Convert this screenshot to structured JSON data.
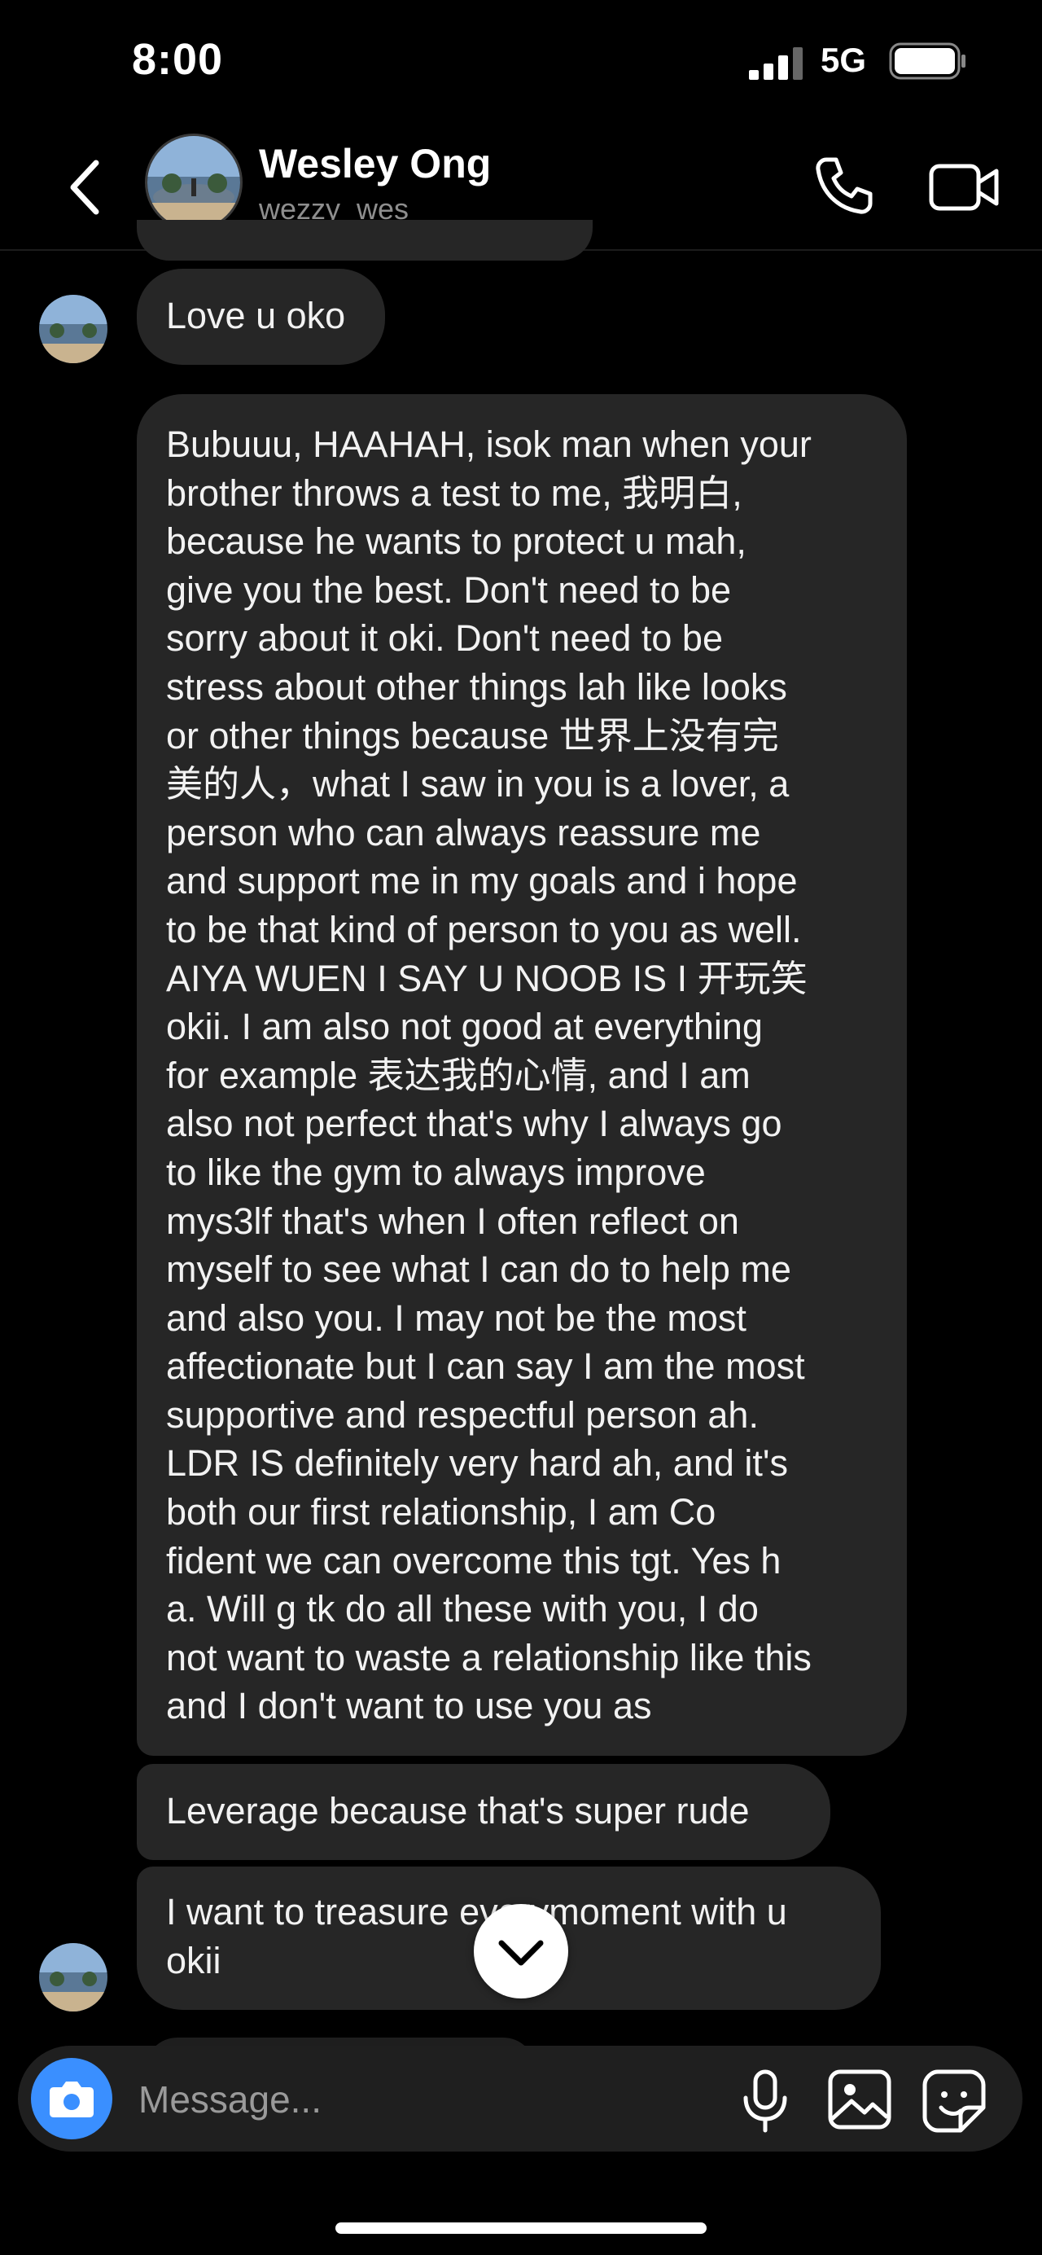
{
  "status_bar": {
    "time": "8:00",
    "network": "5G"
  },
  "header": {
    "name": "Wesley Ong",
    "handle": "wezzy_wes"
  },
  "messages": [
    {
      "text": "Love u oko"
    },
    {
      "text": "Bubuuu, HAAHAH, isok man when your\nbrother throws a test to me, 我明白,\nbecause he wants to protect u mah,\ngive you the best. Don't need to be\nsorry about it oki. Don't need to be\nstress about other things lah like looks\nor other things because 世界上没有完\n美的人，what I saw in you is a lover, a\nperson who can always reassure me\nand support me in my goals and i hope\nto be that kind of person to you as well.\nAIYA WUEN I SAY U NOOB IS I 开玩笑\nokii. I am also not good at everything\nfor example 表达我的心情, and I am\nalso not perfect that's why I always go\nto like the gym to always improve\nmys3lf that's when I often reflect on\nmyself to see what I can do to help me\nand also you. I may not be the most\naffectionate but I can say I am the most\nsupportive and respectful person ah.\nLDR IS definitely very hard ah, and it's\nboth our first relationship, I am Co\nfident we can overcome this tgt. Yes h\na. Will g tk do all these with you, I do\nnot want to waste a relationship like this\nand I don't want to use you as"
    },
    {
      "text": "Leverage because that's super rude"
    },
    {
      "text": "I want to treasure everymoment with u\nokii"
    }
  ],
  "composer": {
    "placeholder": "Message..."
  },
  "colors": {
    "background": "#000000",
    "bubble": "#262626",
    "accent": "#3a8fff",
    "secondary_text": "#8e8e8e"
  },
  "icons": [
    "signal-icon",
    "battery-icon",
    "back-chevron-icon",
    "phone-icon",
    "video-icon",
    "chevron-down-icon",
    "camera-icon",
    "microphone-icon",
    "gallery-icon",
    "sticker-icon"
  ]
}
